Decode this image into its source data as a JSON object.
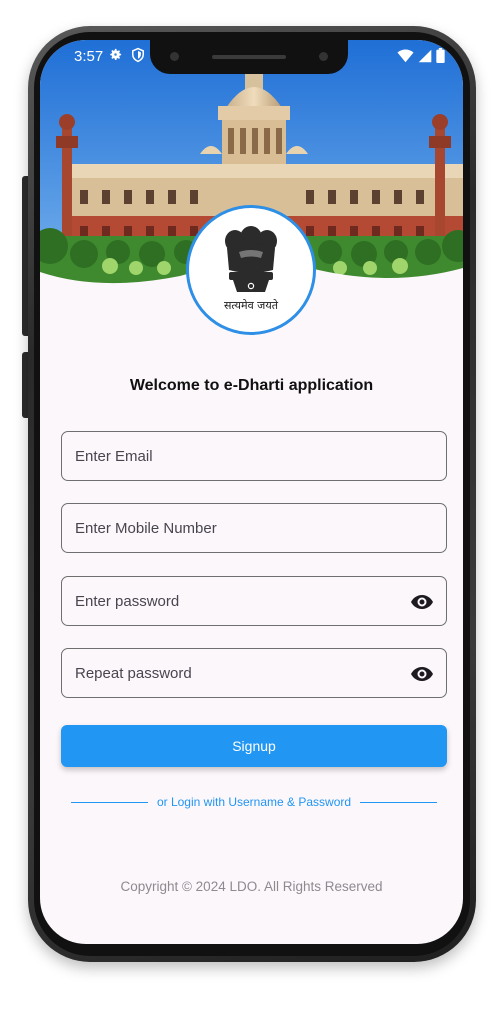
{
  "status_bar": {
    "time": "3:57",
    "left_icons": [
      "gear-icon",
      "shield-icon"
    ],
    "right_icons": [
      "wifi-icon",
      "signal-icon",
      "battery-icon"
    ]
  },
  "emblem": {
    "motto": "सत्यमेव जयते"
  },
  "welcome_title": "Welcome to e-Dharti application",
  "form": {
    "email_placeholder": "Enter Email",
    "mobile_placeholder": "Enter Mobile Number",
    "password_placeholder": "Enter password",
    "repeat_password_placeholder": "Repeat password"
  },
  "signup_label": "Signup",
  "alt_login_link": "or Login with Username & Password",
  "footer": {
    "copyright": "Copyright © 2024 LDO. All Rights Reserved"
  },
  "colors": {
    "accent": "#2196f3",
    "background": "#fcf7fb",
    "emblem_ring": "#2d8fe6"
  }
}
